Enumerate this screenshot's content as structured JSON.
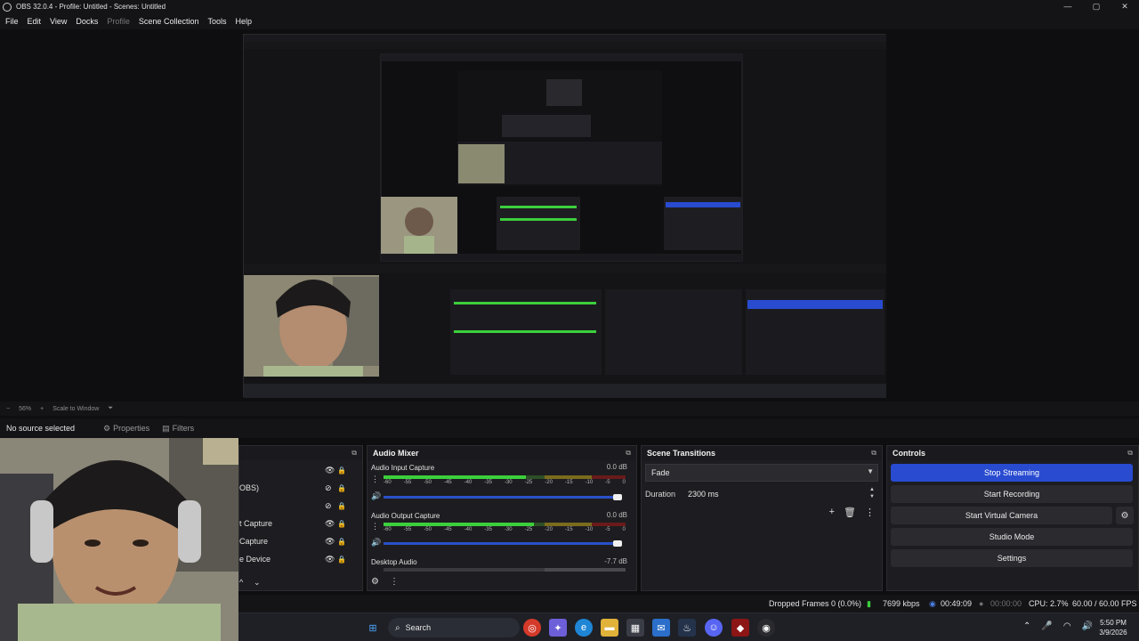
{
  "window": {
    "title": "OBS 32.0.4 - Profile: Untitled - Scenes: Untitled",
    "controls": [
      "—",
      "▢",
      "✕"
    ]
  },
  "menu": [
    "File",
    "Edit",
    "View",
    "Docks",
    "Profile",
    "Scene Collection",
    "Tools",
    "Help"
  ],
  "zoombar": {
    "minus": "−",
    "zoom": "56%",
    "plus": "+",
    "scale": "Scale to Window",
    "caret": "⏷"
  },
  "sourcebar": {
    "no_source": "No source selected",
    "properties": "Properties",
    "filters": "Filters"
  },
  "sources": {
    "rows": [
      {
        "label": "",
        "eye": "👁",
        "lock": "🔒"
      },
      {
        "label": "OBS)",
        "eye": "⊘",
        "lock": "🔒"
      },
      {
        "label": "",
        "eye": "⊘",
        "lock": "🔒"
      },
      {
        "label": "t Capture",
        "eye": "👁",
        "lock": "🔒"
      },
      {
        "label": "Capture",
        "eye": "👁",
        "lock": "🔒"
      },
      {
        "label": "e Device",
        "eye": "👁",
        "lock": "🔒"
      }
    ],
    "footer_chevrons": [
      "^",
      "⌄"
    ]
  },
  "mixer": {
    "title": "Audio Mixer",
    "channels": [
      {
        "name": "Audio Input Capture",
        "db": "0.0 dB",
        "level": 0.59
      },
      {
        "name": "Audio Output Capture",
        "db": "0.0 dB",
        "level": 0.62
      },
      {
        "name": "Desktop Audio",
        "db": "-7.7 dB",
        "level": 0.0
      }
    ],
    "ticks": [
      "-60",
      "-55",
      "-50",
      "-45",
      "-40",
      "-35",
      "-30",
      "-25",
      "-20",
      "-15",
      "-10",
      "-5",
      "0"
    ],
    "footer": [
      "⚙",
      "⋮"
    ]
  },
  "transitions": {
    "title": "Scene Transitions",
    "selected": "Fade",
    "duration_label": "Duration",
    "duration_value": "2300 ms",
    "tools": [
      "+",
      "🗑",
      "⋮"
    ]
  },
  "controls": {
    "title": "Controls",
    "buttons": [
      "Stop Streaming",
      "Start Recording",
      "Start Virtual Camera",
      "Studio Mode",
      "Settings"
    ],
    "accent": "#284bd0"
  },
  "status": {
    "dropped": "Dropped Frames 0 (0.0%)",
    "kbps": "7699 kbps",
    "stream_time": "00:49:09",
    "rec_time": "00:00:00",
    "cpu": "CPU: 2.7%",
    "fps": "60.00 / 60.00 FPS"
  },
  "taskbar": {
    "search": "Search",
    "time": "5:50 PM",
    "date": "3/9/2026"
  }
}
